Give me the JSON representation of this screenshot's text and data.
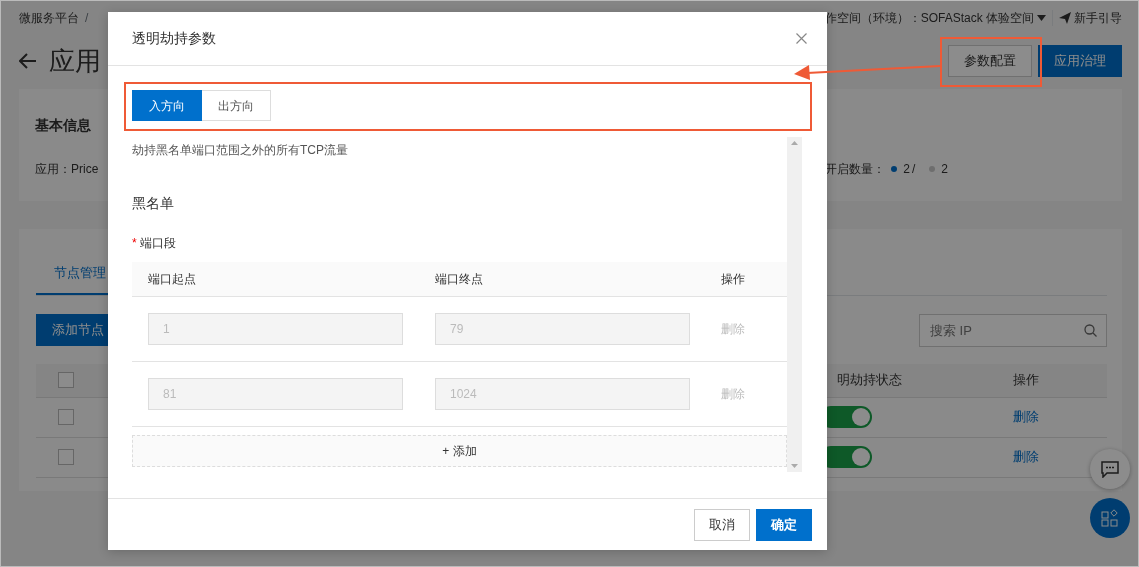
{
  "breadcrumb": {
    "items": [
      "微服务平台"
    ],
    "separator": "/"
  },
  "page_title": "应用",
  "header": {
    "workspace": "作空间（环境）：SOFAStack 体验空间",
    "guide": "新手引导"
  },
  "actions": [
    {
      "label": "参数配置",
      "kind": "secondary"
    },
    {
      "label": "应用治理",
      "kind": "primary"
    }
  ],
  "basic_info": {
    "title": "基本信息",
    "app": "应用：Price",
    "enabled_label": "开启数量：",
    "counts": [
      {
        "value": "2",
        "kind": "enabled"
      },
      {
        "value": "2",
        "kind": "total"
      }
    ],
    "count_separator": "/"
  },
  "node_panel": {
    "tabs": [
      {
        "label": "节点管理",
        "selected": true
      }
    ],
    "add_button": "添加节点",
    "search": {
      "placeholder": "搜索 IP"
    },
    "columns": [
      "明劫持状态",
      "操作"
    ],
    "header_checked": false,
    "rows": [
      {
        "checked": false,
        "on": true,
        "action": "删除"
      },
      {
        "checked": false,
        "on": true,
        "action": "删除"
      }
    ]
  },
  "dialog": {
    "title": "透明劫持参数",
    "tabs": [
      {
        "label": "入方向",
        "selected": true
      },
      {
        "label": "出方向",
        "selected": false
      }
    ],
    "description": "劫持黑名单端口范围之外的所有TCP流量",
    "section": "黑名单",
    "field": {
      "label": "端口段",
      "required": true,
      "required_mark": "*"
    },
    "columns": [
      "端口起点",
      "端口终点",
      "操作"
    ],
    "rows": [
      {
        "start": "1",
        "end": "79",
        "action": "删除",
        "disabled": true
      },
      {
        "start": "81",
        "end": "1024",
        "action": "删除",
        "disabled": true
      }
    ],
    "add_button": "+ 添加",
    "buttons": [
      {
        "label": "取消",
        "kind": "secondary"
      },
      {
        "label": "确定",
        "kind": "primary"
      }
    ]
  },
  "annotations": {
    "highlight_tabs": true,
    "highlight_config": true,
    "arrow": true
  }
}
